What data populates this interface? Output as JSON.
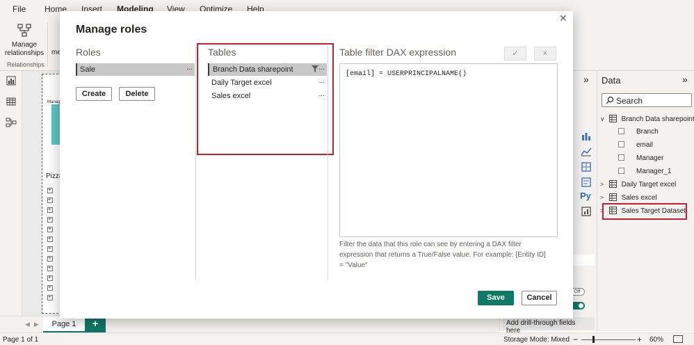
{
  "menu": {
    "items": [
      "File",
      "Home",
      "Insert",
      "Modeling",
      "View",
      "Optimize",
      "Help"
    ]
  },
  "ribbon": {
    "manage_relationships_line1": "Manage",
    "manage_relationships_line2": "relationships",
    "group_label": "Relationships",
    "partial_label": "me"
  },
  "canvas": {
    "visual_title_partial": "Pizza",
    "mini_label": "Manag"
  },
  "modal": {
    "title": "Manage roles",
    "roles": {
      "header": "Roles",
      "items": [
        {
          "label": "Sale"
        }
      ],
      "create_label": "Create",
      "delete_label": "Delete"
    },
    "tables": {
      "header": "Tables",
      "items": [
        {
          "label": "Branch Data sharepoint"
        },
        {
          "label": "Daily Target excel"
        },
        {
          "label": "Sales excel"
        }
      ]
    },
    "dax": {
      "header": "Table filter DAX expression",
      "check_glyph": "✓",
      "cancel_glyph": "×",
      "expression": "[email] = USERPRINCIPALNAME()",
      "help_text": "Filter the data that this role can see by entering a DAX filter expression that returns a True/False value. For example: [Entity ID] = \"Value\""
    },
    "save_label": "Save",
    "cancel_label": "Cancel",
    "more_glyph": "..."
  },
  "viz_pane": {
    "toggle_off_label": "Off",
    "drill_label": "Add drill-through fields here",
    "py_label": "Py"
  },
  "data_pane": {
    "title": "Data",
    "search_placeholder": "Search",
    "tables": [
      {
        "name": "Branch Data sharepoint",
        "expanded": true,
        "fields": [
          "Branch",
          "email",
          "Manager",
          "Manager_1"
        ]
      },
      {
        "name": "Daily Target excel",
        "expanded": false
      },
      {
        "name": "Sales excel",
        "expanded": false
      },
      {
        "name": "Sales Target Dataset",
        "expanded": false
      }
    ]
  },
  "page_tabs": {
    "current": "Page 1",
    "add": "+"
  },
  "status": {
    "page_info": "Page 1 of 1",
    "storage_mode": "Storage Mode: Mixed",
    "zoom": "60%",
    "zoom_minus": "−",
    "zoom_plus": "+"
  },
  "colors": {
    "accent": "#117865",
    "highlight_red": "#c8202a",
    "selection": "#c8c8c8"
  }
}
